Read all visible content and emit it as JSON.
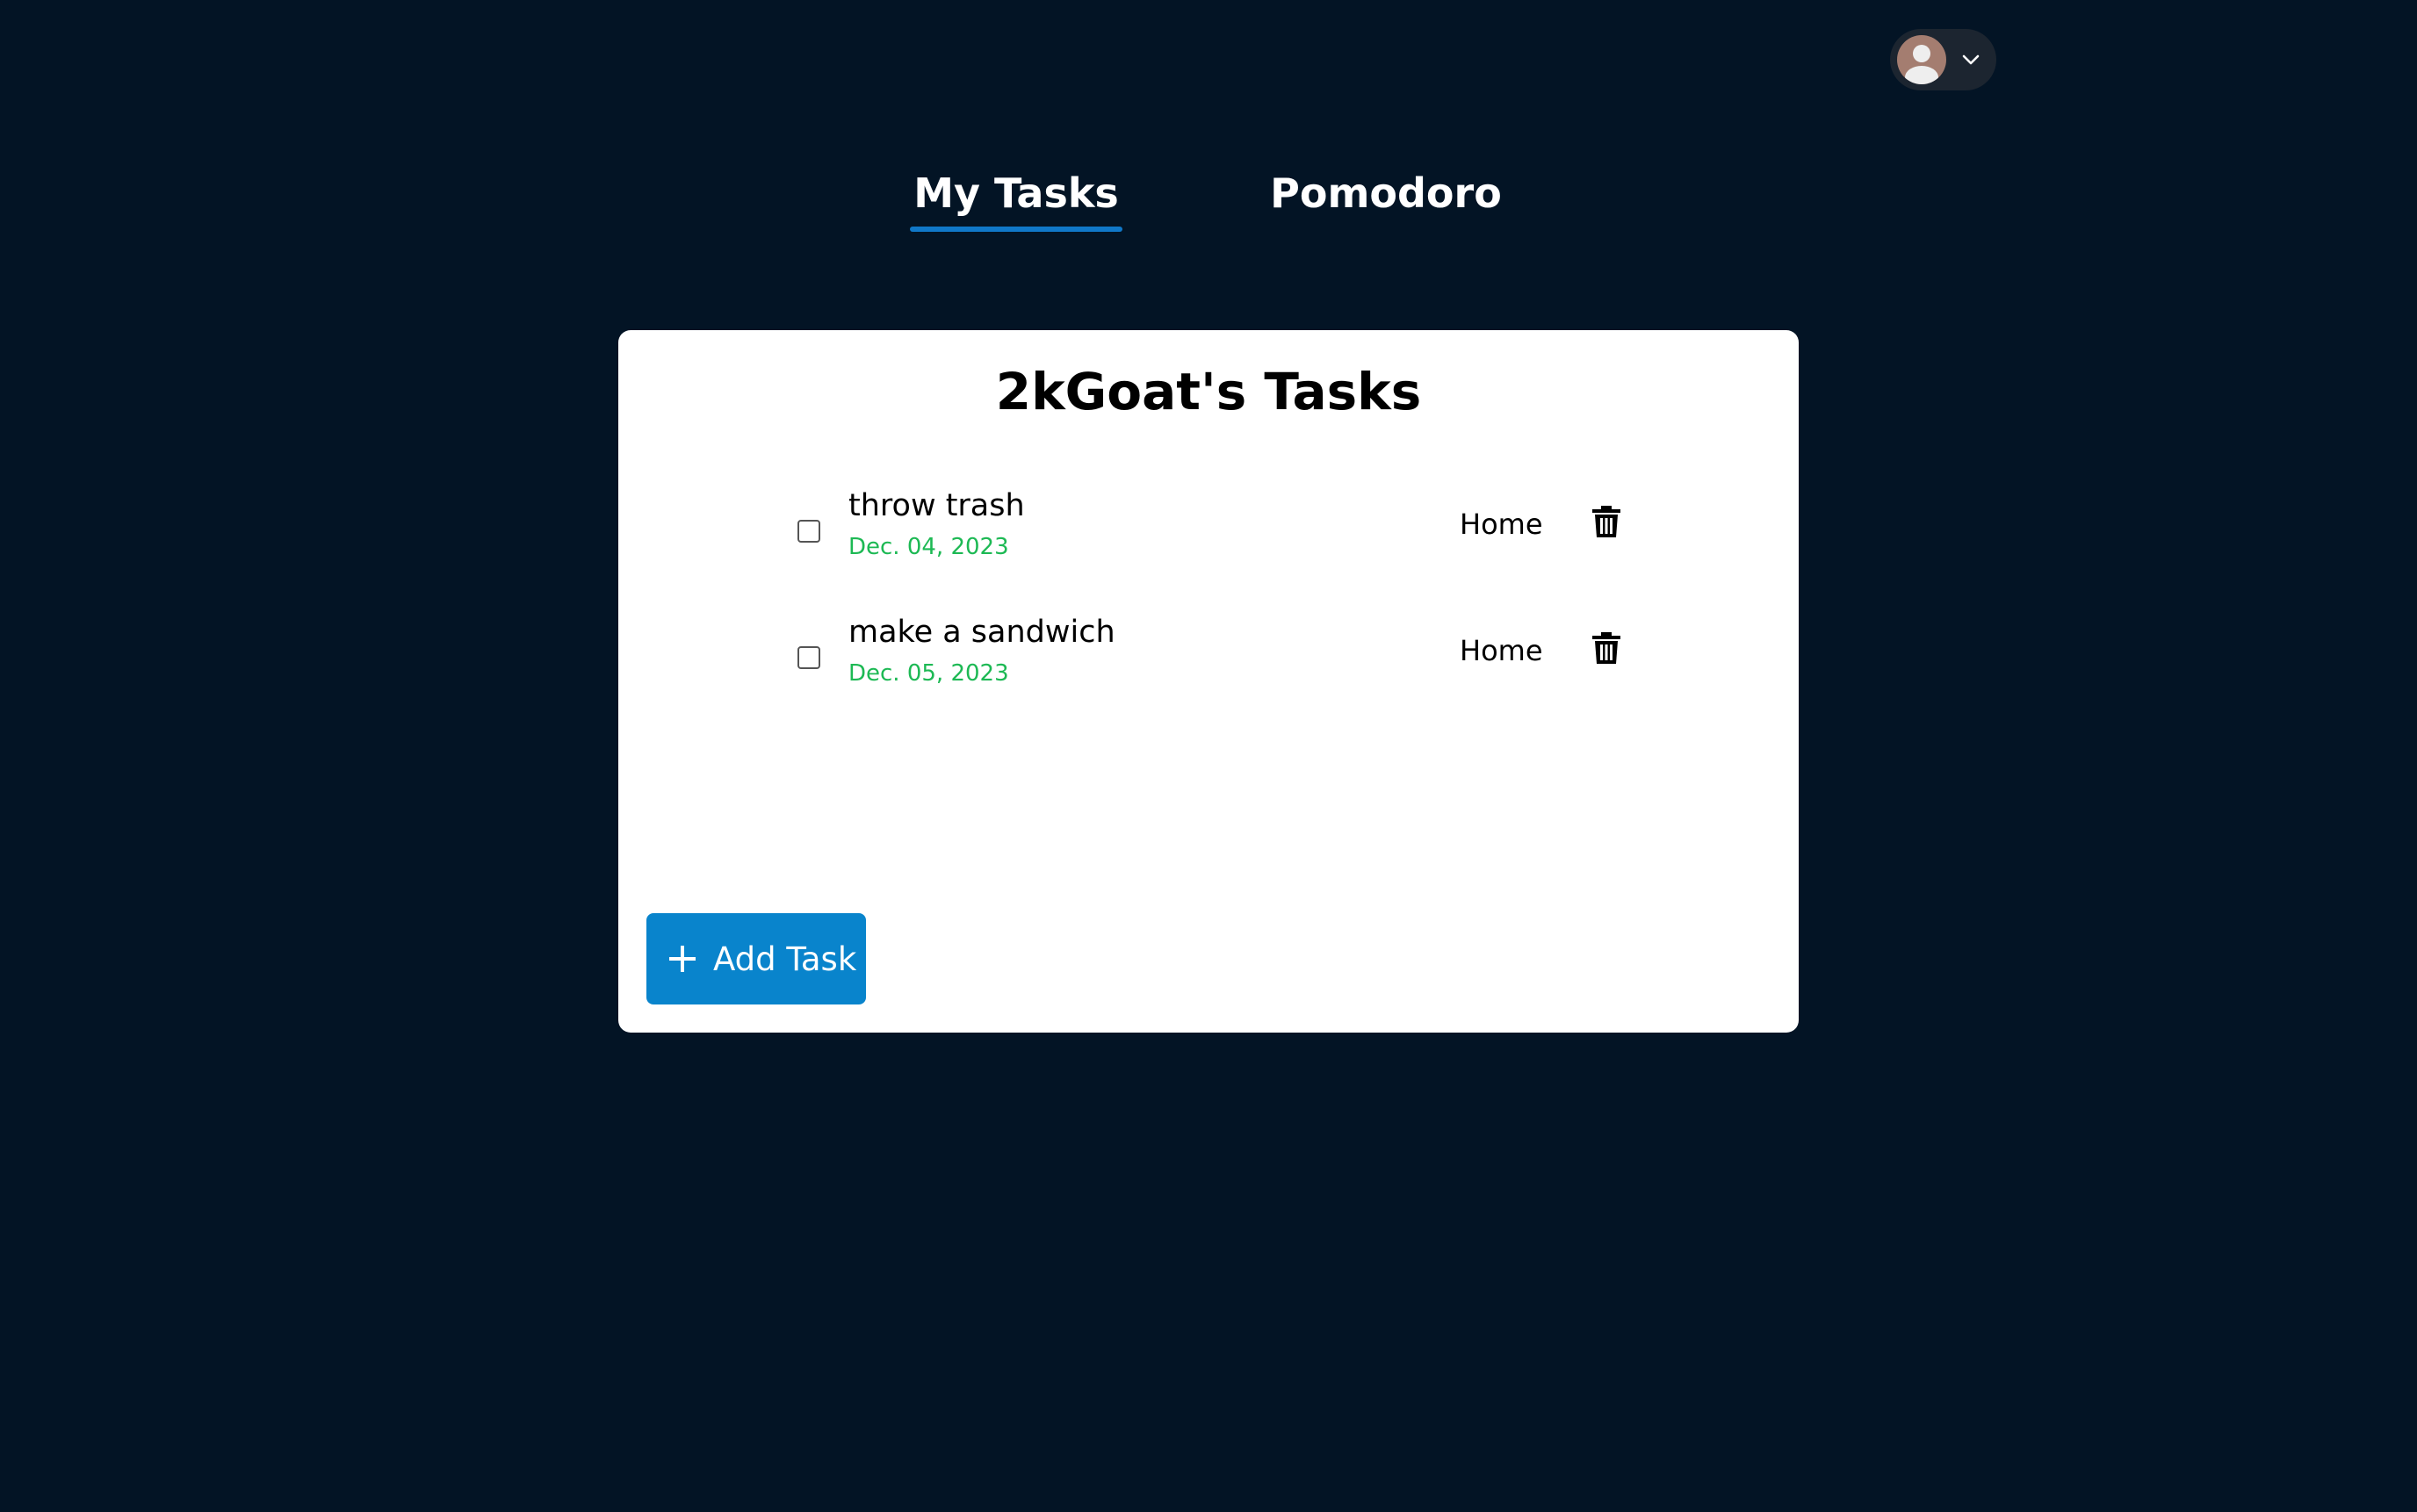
{
  "header": {
    "user_menu_icon": "user-avatar",
    "dropdown_icon": "chevron-down-icon"
  },
  "nav": {
    "tabs": [
      {
        "label": "My Tasks",
        "active": true
      },
      {
        "label": "Pomodoro",
        "active": false
      }
    ],
    "active_color": "#1078c8"
  },
  "task_list": {
    "title": "2kGoat's Tasks",
    "tasks": [
      {
        "title": "throw trash",
        "date": "Dec. 04, 2023",
        "category": "Home",
        "completed": false
      },
      {
        "title": "make a sandwich",
        "date": "Dec. 05, 2023",
        "category": "Home",
        "completed": false
      }
    ],
    "date_color": "#1db954",
    "delete_icon": "trash-icon"
  },
  "actions": {
    "add_task_label": "Add Task",
    "add_icon": "plus-icon",
    "button_color": "#0984cc"
  },
  "colors": {
    "background": "#031425",
    "card": "#ffffff"
  }
}
